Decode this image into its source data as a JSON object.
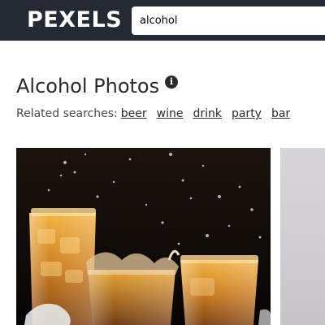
{
  "header": {
    "logo": "PEXELS",
    "search": {
      "value": "alcohol",
      "placeholder": ""
    }
  },
  "main": {
    "title": "Alcohol Photos",
    "info_icon": "info-icon",
    "related_label": "Related searches:",
    "related": [
      "beer",
      "wine",
      "drink",
      "party",
      "bar"
    ]
  },
  "colors": {
    "topbar": "#232a34",
    "text": "#2a2a2a"
  }
}
